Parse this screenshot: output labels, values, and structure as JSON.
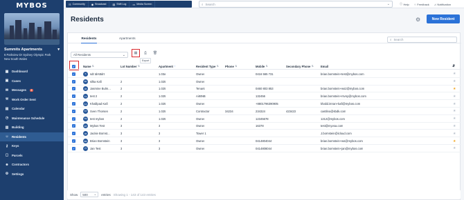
{
  "brand": {
    "logo_text": "MYBOS"
  },
  "estate": {
    "name": "Summits Apartments",
    "address_line1": "6 Parkview Dr Sydney Olympic Park",
    "address_line2": "New South Wales"
  },
  "sidebar": {
    "items": [
      {
        "label": "Dashboard",
        "icon": "grid-icon",
        "glyph": "▦"
      },
      {
        "label": "Cases",
        "icon": "briefcase-icon",
        "glyph": "▣"
      },
      {
        "label": "Messages",
        "icon": "mail-icon",
        "glyph": "✉",
        "badge": "2"
      },
      {
        "label": "Work Order Sent",
        "icon": "wrench-icon",
        "glyph": "⚒"
      },
      {
        "label": "Calendar",
        "icon": "calendar-icon",
        "glyph": "▤"
      },
      {
        "label": "Maintenance Schedule",
        "icon": "clock-icon",
        "glyph": "◷"
      },
      {
        "label": "Building",
        "icon": "building-icon",
        "glyph": "▥"
      },
      {
        "label": "Residents",
        "icon": "people-icon",
        "glyph": "☺",
        "active": true
      },
      {
        "label": "Keys",
        "icon": "key-icon",
        "glyph": "⚷"
      },
      {
        "label": "Parcels",
        "icon": "box-icon",
        "glyph": "▢"
      },
      {
        "label": "Contractors",
        "icon": "user-icon",
        "glyph": "☻"
      },
      {
        "label": "Settings",
        "icon": "gear-icon",
        "glyph": "⚙"
      }
    ]
  },
  "topbar": {
    "tabs": [
      {
        "label": "Community",
        "icon": "community-icon",
        "glyph": "☷"
      },
      {
        "label": "Broadcast",
        "icon": "broadcast-icon",
        "glyph": "◉"
      },
      {
        "label": "Shift Log",
        "icon": "log-icon",
        "glyph": "▤"
      },
      {
        "label": "Media Screen",
        "icon": "screen-icon",
        "glyph": "▭"
      }
    ],
    "search_placeholder": "Search",
    "help_label": "Help",
    "feedback_label": "Feedback",
    "notification_label": "Notification"
  },
  "page": {
    "title": "Residents",
    "new_button": "New Resident"
  },
  "tabs": [
    {
      "label": "Residents",
      "active": true
    },
    {
      "label": "Apartments"
    }
  ],
  "card_search_placeholder": "Search",
  "filter": {
    "value": "All Residents"
  },
  "tooltip": "Export",
  "table": {
    "columns": [
      "Name",
      "Lot Number",
      "Apartment",
      "Resident Type",
      "Phone",
      "Mobile",
      "Secondary Phone",
      "Email"
    ],
    "rows": [
      {
        "initials": "S",
        "name": "sdt tdrsttdrt",
        "lot": "",
        "apt": "1.03a",
        "type": "Owner",
        "phone": "",
        "mobile": "0416 565 731",
        "secondary": "",
        "email": "brian.bornstein+test@mybos.com",
        "star": false
      },
      {
        "initials": "SK",
        "name": "silka Kafi",
        "lot": "2",
        "apt": "1.025",
        "type": "Owner",
        "phone": "",
        "mobile": "",
        "secondary": "",
        "email": "",
        "star": false
      },
      {
        "initials": "JB",
        "name": "Jasmine Bulm...",
        "lot": "2",
        "apt": "1.025",
        "type": "Tenant",
        "phone": "",
        "mobile": "0460 803 853",
        "secondary": "",
        "email": "brian.bornstein+ws2@mybos.com",
        "star": true
      },
      {
        "initials": "T2",
        "name": "test 2",
        "lot": "2",
        "apt": "1.025",
        "type": "AirBNB",
        "phone": "",
        "mobile": "132456",
        "secondary": "",
        "email": "brian.bornstein+rsvny@mybos.com",
        "star": false
      },
      {
        "initials": "KA",
        "name": "Khalilpad Kafi",
        "lot": "2",
        "apt": "1.025",
        "type": "Owner",
        "phone": "",
        "mobile": "+8801796390905",
        "secondary": "",
        "email": "khalid.imran+kafi@mybos.com",
        "star": false
      },
      {
        "initials": "ST",
        "name": "Sven Thorsen",
        "lot": "2",
        "apt": "1.025",
        "type": "Contractor",
        "phone": "34234",
        "mobile": "234324",
        "secondary": "423423",
        "email": "castlino@sbdk.com",
        "star": false
      },
      {
        "initials": "TM",
        "name": "test mybos",
        "lot": "2",
        "apt": "1.025",
        "type": "Owner",
        "phone": "",
        "mobile": "12345678",
        "secondary": "",
        "email": "1212@mybos.com",
        "star": false
      },
      {
        "initials": "MT",
        "name": "Mybos Test",
        "lot": "3",
        "apt": "3",
        "type": "Owner",
        "phone": "",
        "mobile": "16378",
        "secondary": "",
        "email": "test@myvoa.com",
        "star": false
      },
      {
        "initials": "JB",
        "name": "Jackie Bornst...",
        "lot": "3",
        "apt": "3",
        "type": "Tower 1",
        "phone": "",
        "mobile": "",
        "secondary": "",
        "email": "J.bornstein@icloud.com",
        "star": false
      },
      {
        "initials": "BB",
        "name": "Brian Bornstein",
        "lot": "3",
        "apt": "3",
        "type": "Owner",
        "phone": "",
        "mobile": "0414804044",
        "secondary": "",
        "email": "brian.bornstein+ws@mybos.com",
        "star": true
      },
      {
        "initials": "JT",
        "name": "Jan Test",
        "lot": "3",
        "apt": "3",
        "type": "Owner",
        "phone": "",
        "mobile": "0414808044",
        "secondary": "",
        "email": "brian.bornstein+jan@mybos.com",
        "star": false
      }
    ]
  },
  "footer": {
    "show_label": "Show",
    "page_size": "500",
    "entries_label": "entries",
    "info": "Showing 1 - 143 of 143 entries"
  },
  "colors": {
    "sidebar": "#1d3f6e",
    "accent": "#2b72d8",
    "highlight": "#d9262b",
    "star": "#f2a521"
  }
}
